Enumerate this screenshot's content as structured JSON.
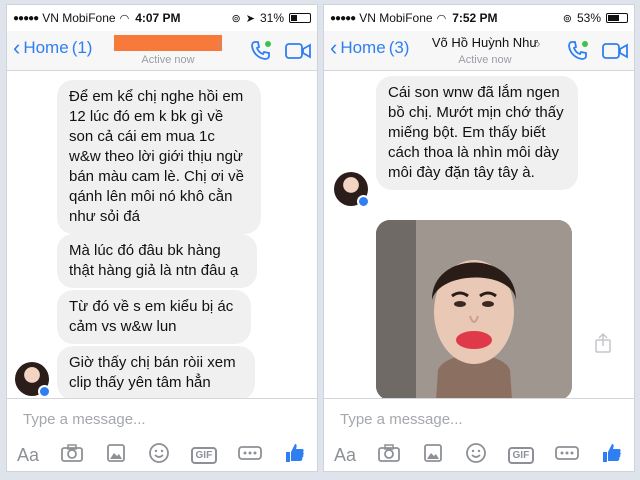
{
  "colors": {
    "accent": "#2f7ff2",
    "redaction": "#f77a3a",
    "bubble": "#f1f0f0"
  },
  "left": {
    "status": {
      "carrier": "VN MobiFone",
      "time": "4:07 PM",
      "battery": "31%",
      "battery_level": 0.31
    },
    "nav": {
      "back_label": "Home",
      "count": "(1)",
      "contact_name": "",
      "active": "Active now"
    },
    "messages": [
      "Để em kể chị nghe hồi em 12 lúc đó em k bk gì về son cả cái em mua 1c w&w theo lời giới thịu ngừ bán màu cam lè. Chị ơi về qánh lên môi nó khô cằn như sỏi đá",
      "Mà lúc đó đâu bk hàng thật hàng giả là ntn đâu ạ",
      "Từ đó về s em kiểu bị ác cảm vs w&w lun",
      "Giờ thấy chị bán ròii xem clip thấy yên tâm hẳn"
    ],
    "composer": {
      "placeholder": "Type a message...",
      "aa": "Aa",
      "gif": "GIF"
    }
  },
  "right": {
    "status": {
      "carrier": "VN MobiFone",
      "time": "7:52 PM",
      "battery": "53%",
      "battery_level": 0.53
    },
    "nav": {
      "back_label": "Home",
      "count": "(3)",
      "contact_name": "Võ Hồ Huỳnh Như",
      "active": "Active now"
    },
    "messages": [
      "Cái son wnw đã lắm ngen bồ chị. Mướt mịn chớ thấy miếng bột. Em thấy biết cách thoa là nhìn môi dày môi đày đặn tây tây à."
    ],
    "composer": {
      "placeholder": "Type a message...",
      "aa": "Aa",
      "gif": "GIF"
    }
  }
}
